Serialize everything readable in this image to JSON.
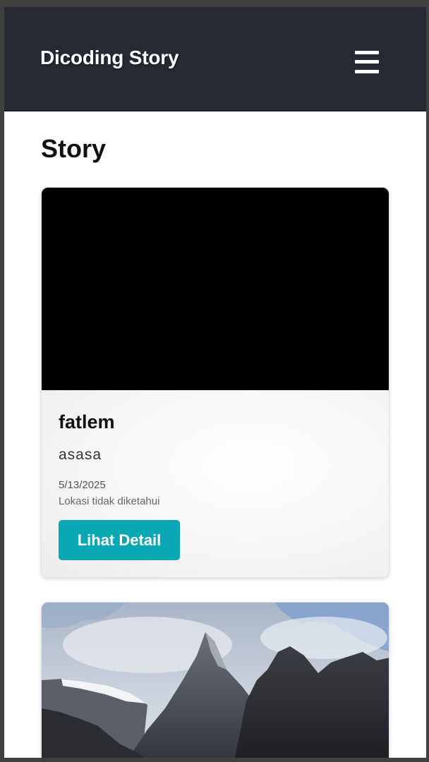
{
  "navbar": {
    "brand": "Dicoding Story",
    "menu_icon": "hamburger-menu-icon"
  },
  "page": {
    "title": "Story"
  },
  "stories": [
    {
      "name": "fatlem",
      "description": "asasa",
      "date": "5/13/2025",
      "location": "Lokasi tidak diketahui",
      "button_label": "Lihat Detail",
      "image": "black-photo"
    },
    {
      "image": "mountain-landscape-photo"
    }
  ],
  "colors": {
    "navbar_bg": "#252a33",
    "button_bg": "#0aa8b5",
    "page_bg": "#ffffff"
  }
}
